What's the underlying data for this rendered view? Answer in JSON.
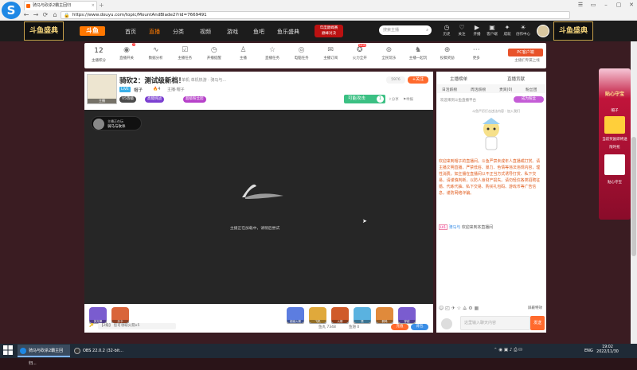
{
  "browser": {
    "tab_title": "骑马与砍杀2霸主回归",
    "url": "https://www.douyu.com/topic/MountAndBlade2?rid=7669491",
    "new_tab": "+",
    "window_controls": [
      "☰",
      "▭",
      "–",
      "▢",
      "✕"
    ]
  },
  "header": {
    "corner_logo_left": "斗鱼盛典",
    "corner_logo_right": "斗鱼盛典",
    "brand": "斗鱼",
    "nav": [
      "首页",
      "直播",
      "分类",
      "视频",
      "游戏",
      "鱼吧",
      "鱼乐盛典"
    ],
    "promo_line1": "年度巅峰赛",
    "promo_line2": "巅峰对决",
    "search_placeholder": "搜索主播",
    "icons": [
      {
        "label": "历史",
        "glyph": "◷"
      },
      {
        "label": "关注",
        "glyph": "♡"
      },
      {
        "label": "开播",
        "glyph": "▶"
      },
      {
        "label": "客户端",
        "glyph": "▣"
      },
      {
        "label": "成就",
        "glyph": "✦"
      },
      {
        "label": "创作中心",
        "glyph": "☀"
      }
    ]
  },
  "toolbar": {
    "fan_count": "12",
    "fan_label": "主播积分",
    "tools": [
      {
        "label": "直播开关",
        "glyph": "◉"
      },
      {
        "label": "数据分析",
        "glyph": "∿"
      },
      {
        "label": "主播任务",
        "glyph": "☑"
      },
      {
        "label": "开播提醒",
        "glyph": "◷"
      },
      {
        "label": "主播",
        "glyph": "♙"
      },
      {
        "label": "直播任务",
        "glyph": "☆"
      },
      {
        "label": "电脑任务",
        "glyph": "◎"
      },
      {
        "label": "主播订阅",
        "glyph": "✉"
      },
      {
        "label": "火力全开",
        "glyph": "✪"
      },
      {
        "label": "全民玩乐",
        "glyph": "⊚"
      },
      {
        "label": "主播一起玩",
        "glyph": "♞"
      },
      {
        "label": "投稿奖励",
        "glyph": "⊕"
      },
      {
        "label": "更多",
        "glyph": "⋯"
      }
    ],
    "recruit_label": "PC客户端",
    "recruit_sub": "主播们专属上线"
  },
  "room": {
    "avatar_tag": "主播",
    "title": "骑砍2：测试级新档！",
    "meta": "单机  单机热游 · 骑马与...",
    "live_tag": "LIVE",
    "streamer_name": "帽子",
    "streamer_rank": "4",
    "room_owner": "主播·帽子",
    "chip_level": "V5等级",
    "chip_title1": "高能挑战",
    "chip_title2": "超级粉丝团",
    "view_count": "5976",
    "follow_label": "关注",
    "host_label": "可能攻击",
    "host_count": "1",
    "share_label": "分享",
    "report_label": "举报"
  },
  "video": {
    "badge_line1": "主播正在玩",
    "badge_line2": "骑马与砍杀",
    "message": "主播正在加载中，请稍后尝试"
  },
  "gifts": [
    {
      "label": "荧光棒",
      "color": "#7a5ccf"
    },
    {
      "label": "办卡",
      "color": "#d9653b"
    },
    {
      "label": "超级火箭",
      "color": "#5c7de0"
    },
    {
      "label": "飞机",
      "color": "#e0a93b"
    },
    {
      "label": "火箭",
      "color": "#d05b2a"
    },
    {
      "label": "赞",
      "color": "#5ab2e0"
    },
    {
      "label": "弱鸡",
      "color": "#e08a3b"
    },
    {
      "label": "穿越",
      "color": "#7a5ccf"
    }
  ],
  "bottom": {
    "key_icon": "🔑",
    "level": "【2级】 您可领取火箭x5",
    "fish_ball": "鱼丸 7348",
    "yuchi": "鱼翅 0",
    "recharge": "充值",
    "backpack": "背包"
  },
  "chat": {
    "tabs": [
      "主播榜单",
      "直播贡献"
    ],
    "subtabs": [
      "日活跃榜",
      "周活跃榜",
      "贵宾(0)",
      "粉丝团"
    ],
    "announcement": "欢迎来到斗鱼直播平台",
    "join_club": "成为粉丝",
    "caption": "斗鱼严厉打击违法内容 - 加入我们",
    "system_message": "欢迎来到帽子的直播间。斗鱼严禁未成年人直播或打赏。请主播文明直播，严禁低俗、暴力、色情等违法违规内容，理性消费。如主播在直播间以不正当方式诱导打赏、私下交易，请谨慎判断，以防人身财产损失。请勿轻信各类招聘征婚、代练代抽、私下交易、购买礼包码、游戏币等广告信息，谨防网络诈骗。",
    "welcome_level": "LV1",
    "welcome_name": "骑马与",
    "welcome_text": "欢迎来到本直播间",
    "tools": "☺ ◰ ✈ ☆ ⟁ ⚙ ▦",
    "mask_label": "屏蔽特效",
    "input_placeholder": "这里输入聊天内容",
    "send_label": "发送"
  },
  "ad": {
    "title": "贴心守宝",
    "sub1": "帽子",
    "sub2": "当前奖励即将送",
    "sub3": "限时抢",
    "sub4": "贴心守宝"
  },
  "taskbar": {
    "items": [
      "骑马与砍杀2霸主回归...",
      "OBS 22.0.2 (32-bit..."
    ],
    "tray": "⌃ ◉ ▣ ♪ ⎙ ⛁",
    "lang": "ENG",
    "time": "19:02",
    "date": "2022/11/30"
  }
}
